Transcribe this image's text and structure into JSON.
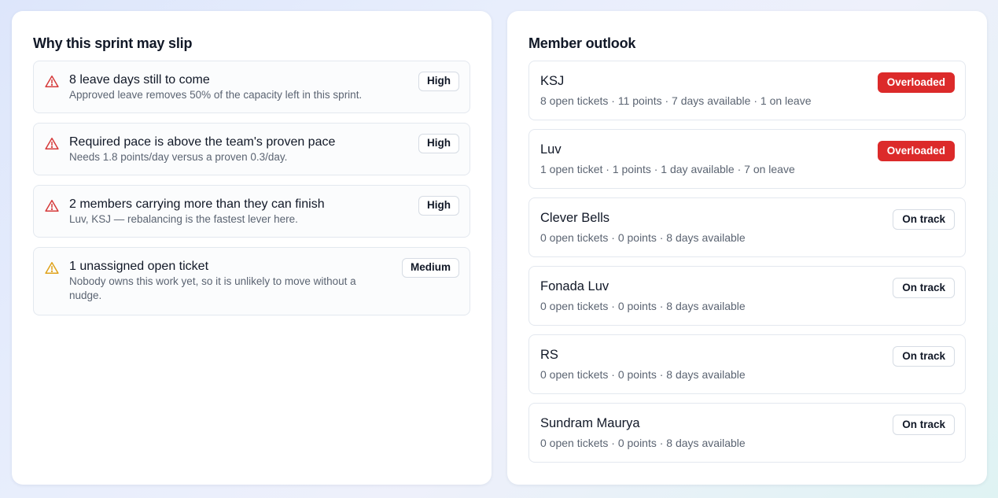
{
  "risks": {
    "title": "Why this sprint may slip",
    "items": [
      {
        "icon": "warning-triangle-icon",
        "title": "8 leave days still to come",
        "description": "Approved leave removes 50% of the capacity left in this sprint.",
        "severity": "High",
        "color": "#d63a3a"
      },
      {
        "icon": "warning-triangle-icon",
        "title": "Required pace is above the team's proven pace",
        "description": "Needs 1.8 points/day versus a proven 0.3/day.",
        "severity": "High",
        "color": "#d63a3a"
      },
      {
        "icon": "warning-triangle-icon",
        "title": "2 members carrying more than they can finish",
        "description": "Luv, KSJ — rebalancing is the fastest lever here.",
        "severity": "High",
        "color": "#d63a3a"
      },
      {
        "icon": "warning-triangle-icon",
        "title": "1 unassigned open ticket",
        "description": "Nobody owns this work yet, so it is unlikely to move without a nudge.",
        "severity": "Medium",
        "color": "#e0a21a"
      }
    ]
  },
  "members": {
    "title": "Member outlook",
    "items": [
      {
        "name": "KSJ",
        "stats": "8 open tickets · 11 points · 7 days available · 1 on leave",
        "status": "Overloaded",
        "status_type": "overloaded"
      },
      {
        "name": "Luv",
        "stats": "1 open ticket · 1 points · 1 day available · 7 on leave",
        "status": "Overloaded",
        "status_type": "overloaded"
      },
      {
        "name": "Clever Bells",
        "stats": "0 open tickets · 0 points · 8 days available",
        "status": "On track",
        "status_type": "ontrack"
      },
      {
        "name": "Fonada Luv",
        "stats": "0 open tickets · 0 points · 8 days available",
        "status": "On track",
        "status_type": "ontrack"
      },
      {
        "name": "RS",
        "stats": "0 open tickets · 0 points · 8 days available",
        "status": "On track",
        "status_type": "ontrack"
      },
      {
        "name": "Sundram Maurya",
        "stats": "0 open tickets · 0 points · 8 days available",
        "status": "On track",
        "status_type": "ontrack"
      }
    ]
  },
  "colors": {
    "overloaded": "#dc2a2a",
    "high_icon": "#d63a3a",
    "medium_icon": "#e0a21a"
  }
}
